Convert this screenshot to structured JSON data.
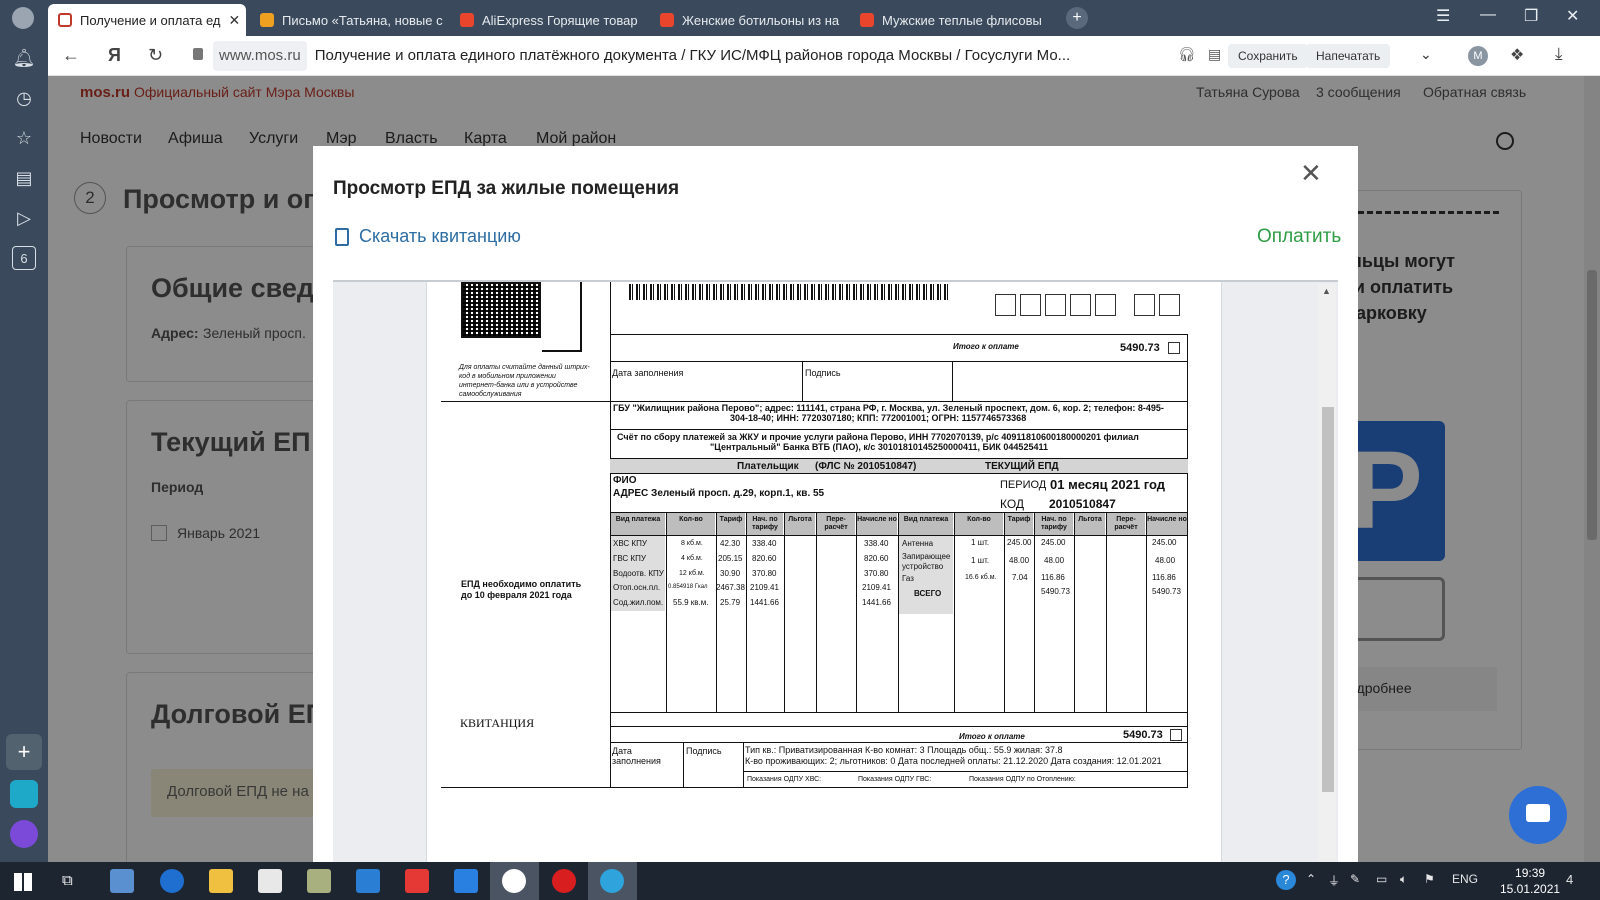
{
  "tabs": [
    {
      "label": "Получение и оплата ед",
      "active": true
    },
    {
      "label": "Письмо «Татьяна, новые с"
    },
    {
      "label": "AliExpress Горящие товар"
    },
    {
      "label": "Женские ботильоны из на"
    },
    {
      "label": "Мужские теплые флисовы"
    }
  ],
  "address": {
    "host": "www.mos.ru",
    "title": "Получение и оплата единого платёжного документа / ГКУ ИС/МФЦ районов города Москвы / Госуслуги Мо...",
    "save": "Сохранить",
    "print": "Напечатать",
    "profile_letter": "М"
  },
  "site": {
    "logo": "mos.ru",
    "logo_sub": "Официальный сайт Мэра Москвы",
    "user": "Татьяна Сурова",
    "messages": "3 сообщения",
    "feedback": "Обратная связь",
    "nav": [
      "Новости",
      "Афиша",
      "Услуги",
      "Мэр",
      "Власть",
      "Карта",
      "Мой район"
    ],
    "step_number": "2",
    "step_title": "Просмотр и опл",
    "general_title": "Общие свед",
    "address_label": "Адрес:",
    "address_value": "Зеленый просп.",
    "current_title": "Текущий ЕП",
    "period_label": "Период",
    "period_value": "Январь 2021",
    "debt_title": "Долговой ЕП",
    "debt_note": "Долговой ЕПД не на",
    "right_text": [
      "дельцы могут",
      "ть и оплатить",
      "и парковку"
    ],
    "more": "Подробнее"
  },
  "modal": {
    "title": "Просмотр ЕПД за жилые помещения",
    "download": "Скачать квитанцию",
    "pay": "Оплатить"
  },
  "doc": {
    "qr_note": [
      "Для оплаты считайте данный штрих-",
      "код в мобильном приложении",
      "интернет-банка или в устройстве",
      "самообслуживания"
    ],
    "total_label": "Итого к оплате",
    "total": "5490.73",
    "fill_date": "Дата заполнения",
    "signature": "Подпись",
    "org_line1": "ГБУ \"Жилищник района Перово\"; адрес: 111141, страна РФ, г. Москва, ул. Зеленый проспект, дом. 6, кор. 2; телефон: 8-495-",
    "org_line2": "304-18-40; ИНН: 7720307180; КПП: 772001001; ОГРН: 1157746573368",
    "bank_line1": "Счёт по сбору платежей за ЖКУ и прочие услуги района Перово, ИНН 7702070139, р/с 40911810600180000201 филиал",
    "bank_line2": "\"Центральный\" Банка ВТБ (ПАО), к/с 30101810145250000411, БИК 044525411",
    "payer": "Плательщик",
    "fls": "(ФЛС № 2010510847)",
    "current_epd": "ТЕКУЩИЙ ЕПД",
    "fio": "ФИО",
    "adres": "АДРЕС  Зеленый просп. д.29, корп.1, кв. 55",
    "period_label": "ПЕРИОД",
    "period_value": "01 месяц 2021 год",
    "code_label": "КОД",
    "code_value": "2010510847",
    "due_note": [
      "ЕПД необходимо оплатить",
      "до 10 февраля 2021 года"
    ],
    "kvit": "КВИТАНЦИЯ",
    "headers": [
      "Вид платежа",
      "Кол-во",
      "Тариф",
      "Нач. по тарифу",
      "Льгота",
      "Пере- расчёт",
      "Начисле но",
      "Вид платежа",
      "Кол-во",
      "Тариф",
      "Нач. по тарифу",
      "Льгота",
      "Пере- расчёт",
      "Начисле но"
    ],
    "left_rows": [
      {
        "name": "ХВС КПУ",
        "qty": "8 кб.м.",
        "tariff": "42.30",
        "accr": "338.40",
        "total": "338.40"
      },
      {
        "name": "ГВС КПУ",
        "qty": "4 кб.м.",
        "tariff": "205.15",
        "accr": "820.60",
        "total": "820.60"
      },
      {
        "name": "Водоотв. КПУ",
        "qty": "12 кб.м.",
        "tariff": "30.90",
        "accr": "370.80",
        "total": "370.80"
      },
      {
        "name": "Отоп.осн.пл.",
        "qty": "0.854918 Гкал",
        "tariff": "2467.38",
        "accr": "2109.41",
        "total": "2109.41"
      },
      {
        "name": "Сод.жил.пом.",
        "qty": "55.9 кв.м.",
        "tariff": "25.79",
        "accr": "1441.66",
        "total": "1441.66"
      }
    ],
    "right_rows": [
      {
        "name": "Антенна",
        "qty": "1 шт.",
        "tariff": "245.00",
        "accr": "245.00",
        "total": "245.00"
      },
      {
        "name": "Запирающее устройство",
        "qty": "1 шт.",
        "tariff": "48.00",
        "accr": "48.00",
        "total": "48.00"
      },
      {
        "name": "Газ",
        "qty": "16.6 кб.м.",
        "tariff": "7.04",
        "accr": "116.86",
        "total": "116.86"
      }
    ],
    "vsego": "ВСЕГО",
    "vsego_accr": "5490.73",
    "vsego_total": "5490.73",
    "info1": "Тип кв.: Приватизированная К-во комнат: 3 Площадь общ.: 55.9 жилая: 37.8",
    "info2": "К-во проживающих: 2; льготников: 0 Дата последней оплаты: 21.12.2020 Дата создания: 12.01.2021",
    "odpu": [
      "Показания ОДПУ ХВС:",
      "Показания ОДПУ ГВС:",
      "Показания ОДПУ по Отоплению:"
    ]
  },
  "taskbar": {
    "lang": "ENG",
    "time": "19:39",
    "date": "15.01.2021",
    "notif": "4"
  }
}
